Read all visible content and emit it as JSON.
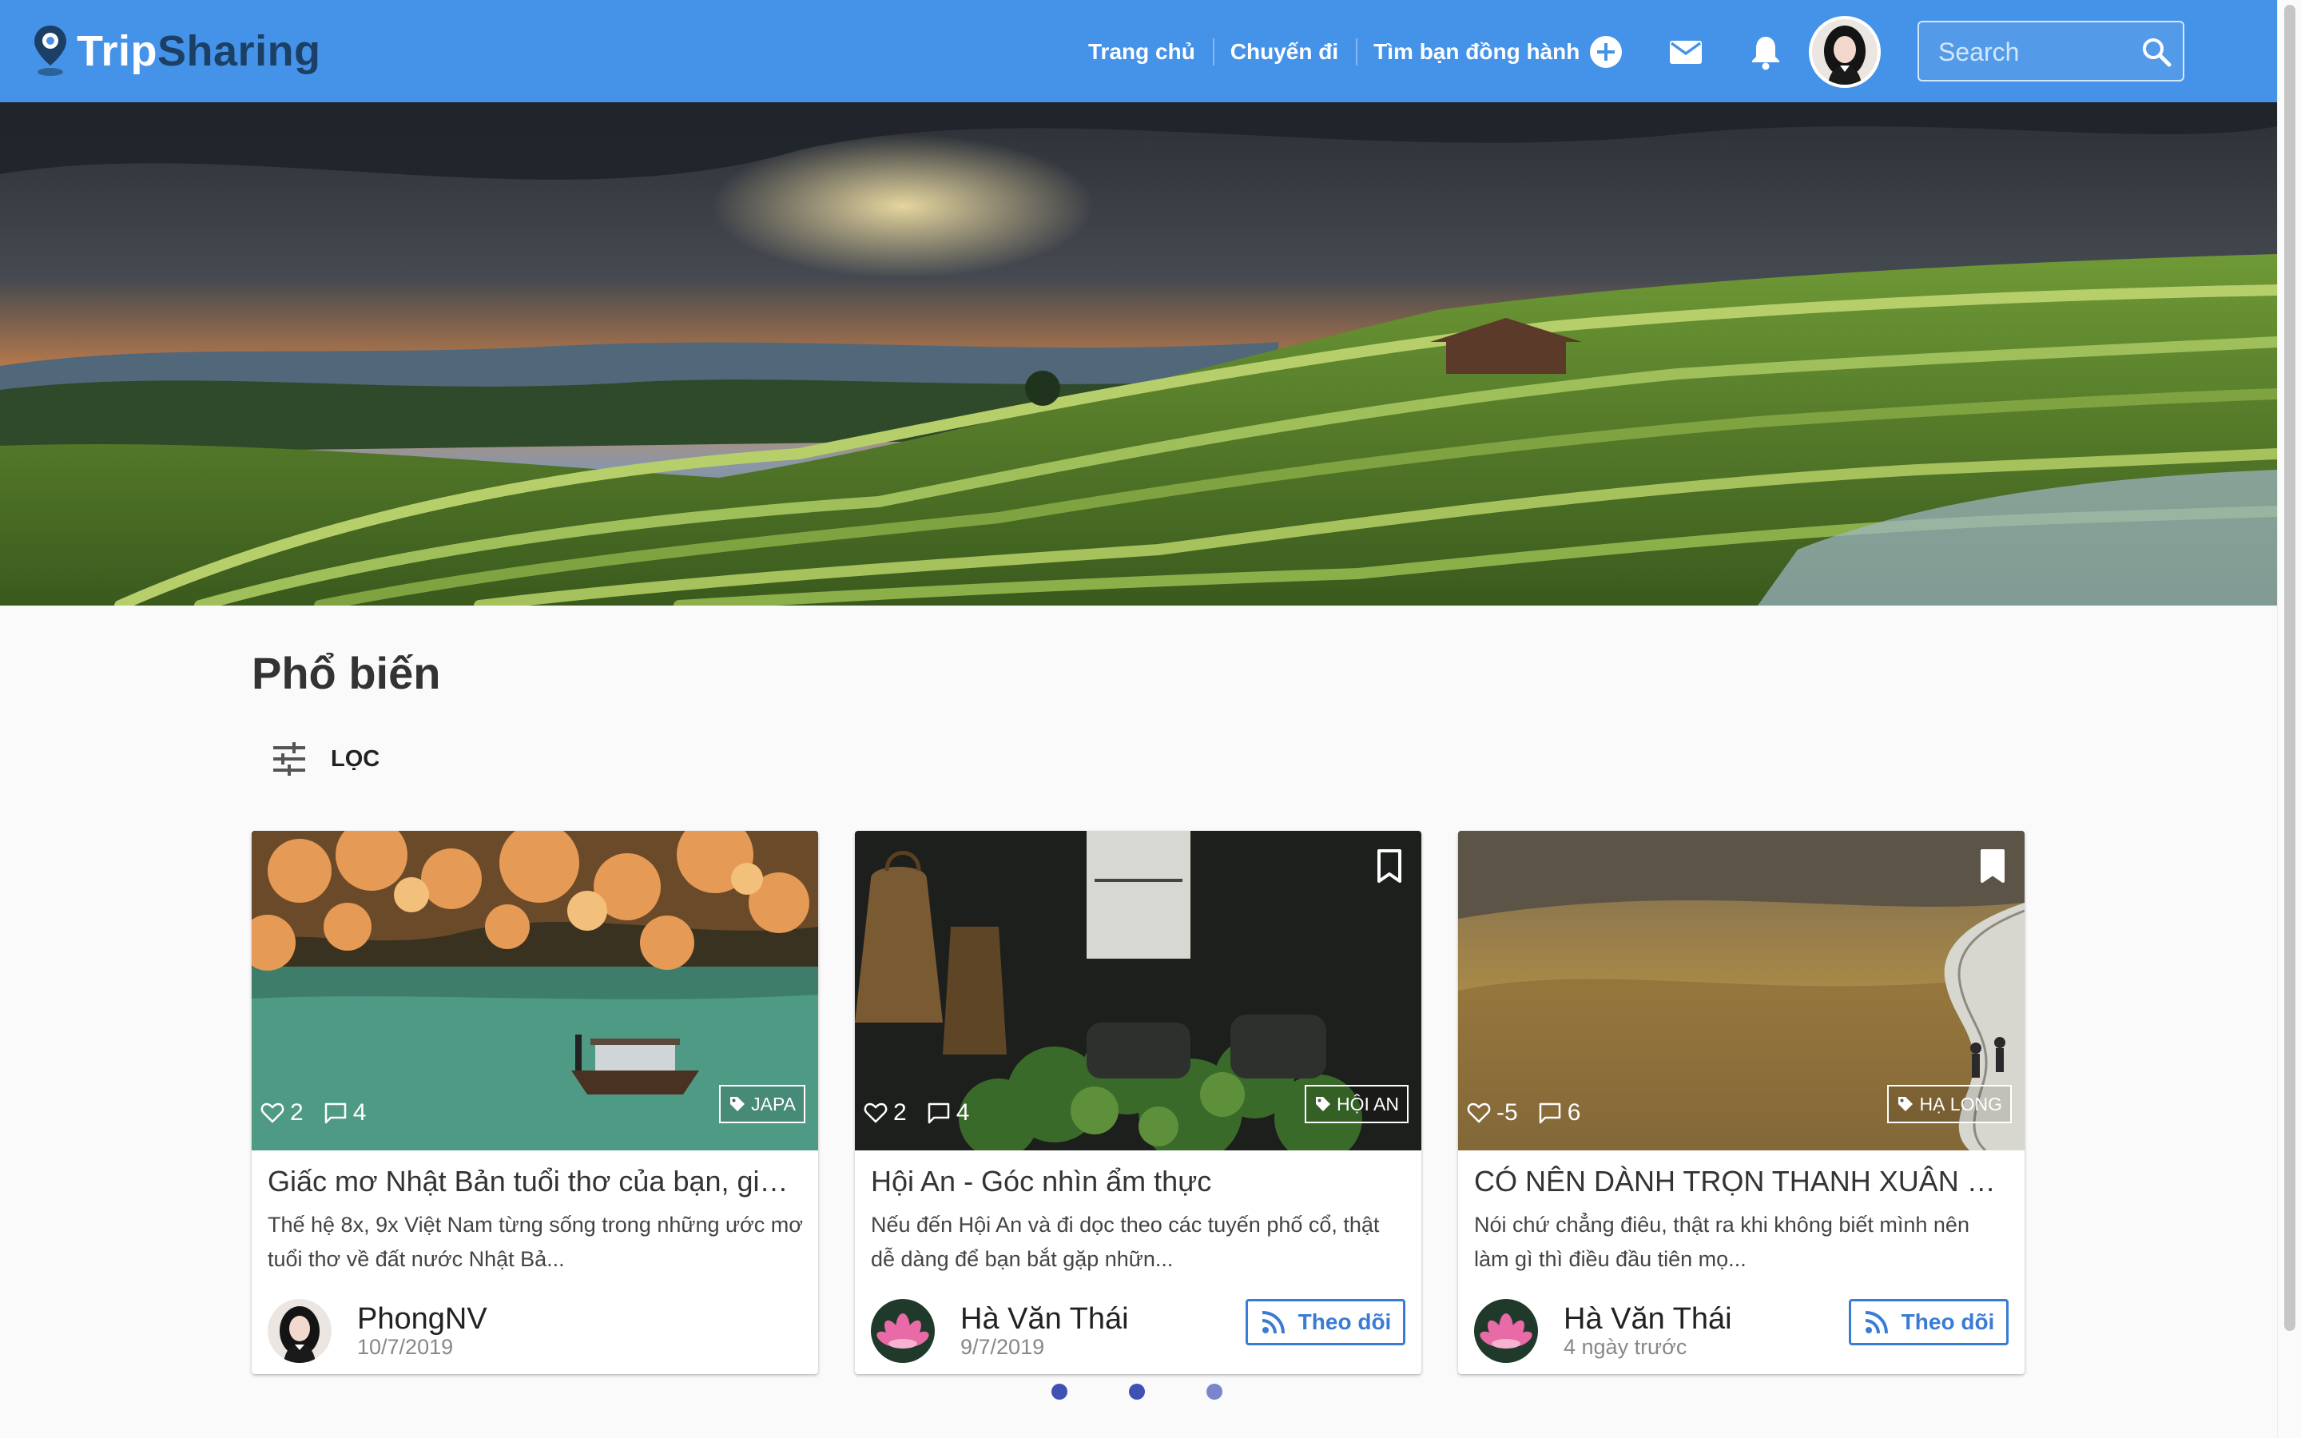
{
  "header": {
    "logo_trip": "Trip",
    "logo_sharing": "Sharing",
    "nav": [
      "Trang chủ",
      "Chuyến đi",
      "Tìm bạn đồng hành"
    ],
    "icons": [
      "add-circle-icon",
      "mail-icon",
      "bell-icon"
    ],
    "search_placeholder": "Search"
  },
  "section": {
    "title": "Phổ biến",
    "filter_label": "LỌC"
  },
  "cards": [
    {
      "likes": "2",
      "comments": "4",
      "tag": "JAPA",
      "title": "Giấc mơ Nhật Bản tuổi thơ của bạn, giờ ...",
      "excerpt": "Thế hệ 8x, 9x Việt Nam từng sống trong những ước mơ tuổi thơ về đất nước Nhật Bả...",
      "author": "PhongNV",
      "date": "10/7/2019",
      "follow": null,
      "bookmark": false
    },
    {
      "likes": "2",
      "comments": "4",
      "tag": "HỘI AN",
      "title": "Hội An - Góc nhìn ẩm thực",
      "excerpt": "Nếu đến Hội An và đi dọc theo các tuyến phố cổ, thật dễ dàng để bạn bắt gặp nhữn...",
      "author": "Hà Văn Thái",
      "date": "9/7/2019",
      "follow": "Theo dõi",
      "bookmark": true
    },
    {
      "likes": "-5",
      "comments": "6",
      "tag": "HẠ LONG",
      "title": "CÓ NÊN DÀNH TRỌN THANH XUÂN ĐỂ ...",
      "excerpt": "Nói chứ chẳng điêu, thật ra khi không biết mình nên làm gì thì điều đầu tiên mọ...",
      "author": "Hà Văn Thái",
      "date": "4 ngày trước",
      "follow": "Theo dõi",
      "bookmark": true
    }
  ],
  "carousel": {
    "pages": 3,
    "active": 1
  },
  "colors": {
    "header": "#4593e8",
    "accent": "#3a7bd5",
    "dot": "#3f51b5"
  }
}
